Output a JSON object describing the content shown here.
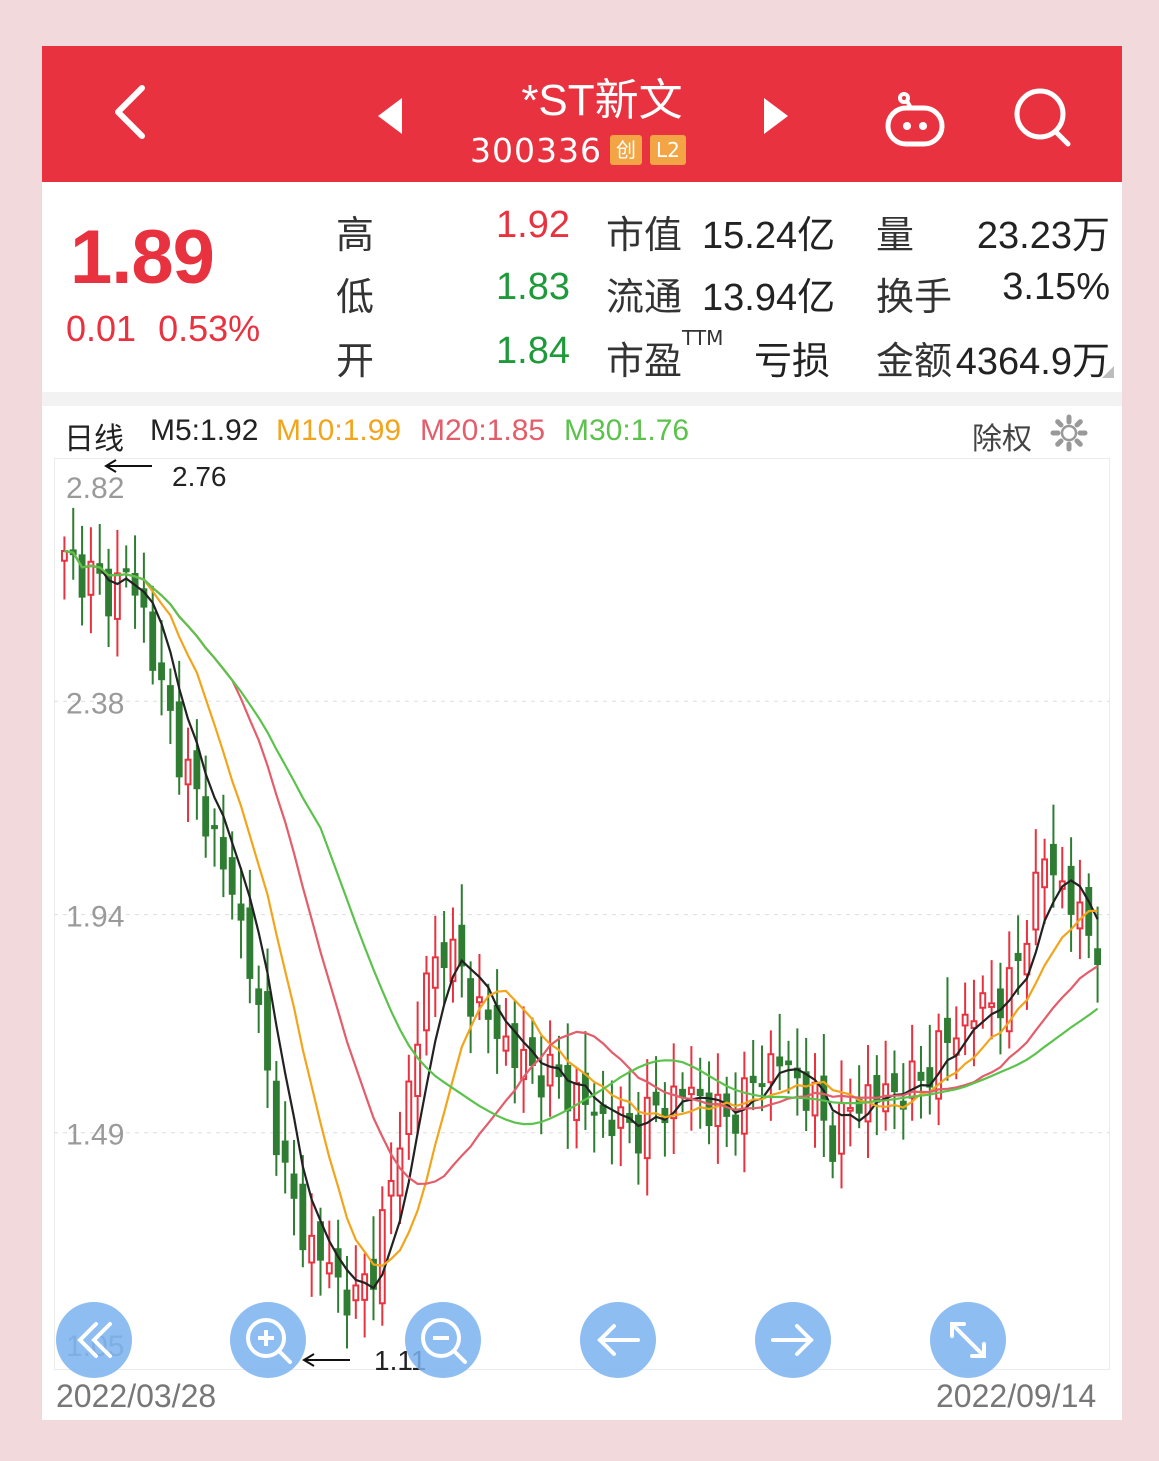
{
  "header": {
    "title": "*ST新文",
    "code": "300336",
    "badges": [
      "创",
      "L2"
    ]
  },
  "quote": {
    "price": "1.89",
    "change": "0.01",
    "change_pct": "0.53%",
    "high_label": "高",
    "high": "1.92",
    "low_label": "低",
    "low": "1.83",
    "open_label": "开",
    "open": "1.84",
    "mktcap_label": "市值",
    "mktcap": "15.24亿",
    "float_label": "流通",
    "float": "13.94亿",
    "pe_label": "市盈",
    "pe_sup": "TTM",
    "pe": "亏损",
    "vol_label": "量",
    "vol": "23.23万",
    "turnover_label": "换手",
    "turnover": "3.15%",
    "amount_label": "金额",
    "amount": "4364.9万"
  },
  "chart_header": {
    "period": "日线",
    "m5": "M5:1.92",
    "m10": "M10:1.99",
    "m20": "M20:1.85",
    "m30": "M30:1.76",
    "adjust": "除权"
  },
  "chart_data": {
    "type": "candlestick",
    "y_ticks": [
      "2.82",
      "2.38",
      "1.94",
      "1.49",
      "1.05"
    ],
    "ylim": [
      1.05,
      2.82
    ],
    "x_start": "2022/03/28",
    "x_end": "2022/09/14",
    "max_annotation": "2.76",
    "min_annotation": "1.11",
    "colors": {
      "up": "#e8323f",
      "down": "#2f7d32",
      "m5": "#222222",
      "m10": "#f2a51c",
      "m20": "#e35d6a",
      "m30": "#5bc24c"
    },
    "anchors": [
      [
        0,
        2.67
      ],
      [
        3,
        2.64
      ],
      [
        5,
        2.6
      ],
      [
        7,
        2.65
      ],
      [
        9,
        2.56
      ],
      [
        11,
        2.4
      ],
      [
        13,
        2.28
      ],
      [
        15,
        2.18
      ],
      [
        17,
        2.1
      ],
      [
        19,
        1.98
      ],
      [
        21,
        1.85
      ],
      [
        23,
        1.6
      ],
      [
        25,
        1.4
      ],
      [
        27,
        1.28
      ],
      [
        29,
        1.24
      ],
      [
        31,
        1.18
      ],
      [
        33,
        1.14
      ],
      [
        35,
        1.22
      ],
      [
        37,
        1.38
      ],
      [
        39,
        1.58
      ],
      [
        41,
        1.8
      ],
      [
        43,
        1.88
      ],
      [
        45,
        1.82
      ],
      [
        47,
        1.74
      ],
      [
        49,
        1.7
      ],
      [
        51,
        1.65
      ],
      [
        53,
        1.62
      ],
      [
        55,
        1.61
      ],
      [
        57,
        1.58
      ],
      [
        59,
        1.55
      ],
      [
        61,
        1.52
      ],
      [
        63,
        1.51
      ],
      [
        65,
        1.5
      ],
      [
        67,
        1.54
      ],
      [
        69,
        1.56
      ],
      [
        71,
        1.58
      ],
      [
        73,
        1.54
      ],
      [
        75,
        1.52
      ],
      [
        77,
        1.56
      ],
      [
        79,
        1.62
      ],
      [
        81,
        1.64
      ],
      [
        83,
        1.6
      ],
      [
        85,
        1.55
      ],
      [
        87,
        1.48
      ],
      [
        89,
        1.54
      ],
      [
        91,
        1.57
      ],
      [
        93,
        1.57
      ],
      [
        95,
        1.58
      ],
      [
        97,
        1.6
      ],
      [
        99,
        1.66
      ],
      [
        101,
        1.7
      ],
      [
        103,
        1.74
      ],
      [
        105,
        1.76
      ],
      [
        107,
        1.78
      ],
      [
        109,
        1.92
      ],
      [
        111,
        2.06
      ],
      [
        113,
        2.0
      ],
      [
        115,
        1.93
      ],
      [
        117,
        1.88
      ]
    ]
  },
  "controls": [
    "shift-left",
    "zoom-in",
    "zoom-out",
    "arrow-left",
    "arrow-right",
    "fullscreen"
  ]
}
